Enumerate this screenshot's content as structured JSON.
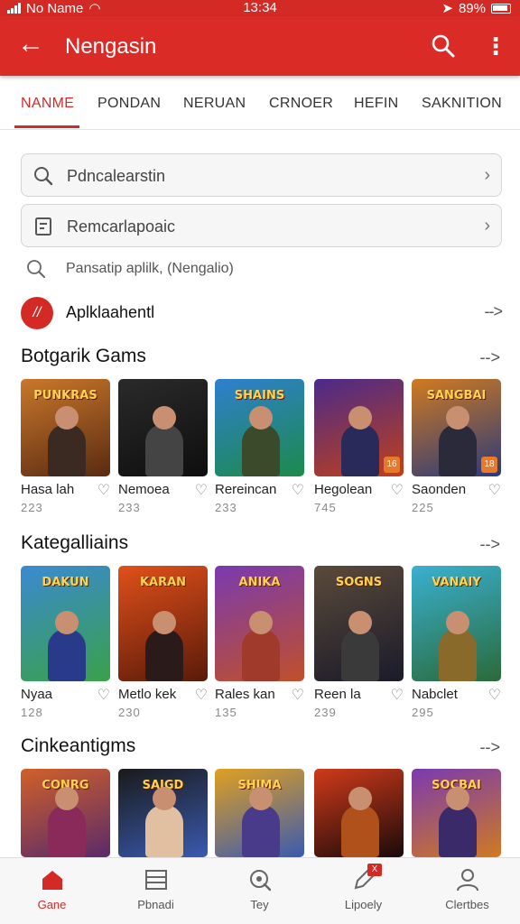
{
  "status_bar": {
    "carrier": "No Name",
    "time": "13:34",
    "battery": "89%"
  },
  "app_bar": {
    "title": "Nengasin"
  },
  "tabs": [
    {
      "label": "NANME",
      "active": true
    },
    {
      "label": "PONDAN",
      "active": false
    },
    {
      "label": "NERUAN",
      "active": false
    },
    {
      "label": "CRNOER",
      "active": false
    },
    {
      "label": "HEFIN",
      "active": false
    },
    {
      "label": "SAKNITION",
      "active": false
    }
  ],
  "fields": [
    {
      "text": "Pdncalearstin",
      "icon": "search-icon"
    },
    {
      "text": "Remcarlapoaic",
      "icon": "document-icon"
    }
  ],
  "plain_search": {
    "text": "Pansatip aplilk, (Nengalio)",
    "icon": "search-icon"
  },
  "featured": {
    "label": "Aplklaahentl",
    "badge": "//",
    "arrow": "-->"
  },
  "sections": [
    {
      "title": "Botgarik Gams",
      "arrow": "-->",
      "items": [
        {
          "name": "Hasa lah",
          "count": "223",
          "banner": "PUNKRAS",
          "colors": [
            "#c9782a",
            "#5a2a12"
          ],
          "hero": "#3a2a22",
          "tag": ""
        },
        {
          "name": "Nemoea",
          "count": "233",
          "banner": "",
          "colors": [
            "#2a2a2a",
            "#0e0e0e"
          ],
          "hero": "#444444",
          "tag": ""
        },
        {
          "name": "Rereincan",
          "count": "233",
          "banner": "SHAINS",
          "colors": [
            "#2f7fd0",
            "#1c8a4a"
          ],
          "hero": "#3a4a2a",
          "tag": ""
        },
        {
          "name": "Hegolean",
          "count": "745",
          "banner": "",
          "colors": [
            "#4a2a8a",
            "#c0401a"
          ],
          "hero": "#2a2a5a",
          "tag": "16"
        },
        {
          "name": "Saonden",
          "count": "225",
          "banner": "SANGBAI",
          "colors": [
            "#d07a20",
            "#2a3a7a"
          ],
          "hero": "#2a2a3a",
          "tag": "18"
        }
      ]
    },
    {
      "title": "Kategalliains",
      "arrow": "-->",
      "items": [
        {
          "name": "Nyaa",
          "count": "128",
          "banner": "DAKUN",
          "colors": [
            "#3a8ad0",
            "#3aa04a"
          ],
          "hero": "#2a3a8a",
          "tag": ""
        },
        {
          "name": "Metlo kek",
          "count": "230",
          "banner": "KARAN",
          "colors": [
            "#e0501a",
            "#5a1a0a"
          ],
          "hero": "#2a1a1a",
          "tag": ""
        },
        {
          "name": "Rales kan",
          "count": "135",
          "banner": "ANIKA",
          "colors": [
            "#7a3ab0",
            "#c0502a"
          ],
          "hero": "#a03a2a",
          "tag": ""
        },
        {
          "name": "Reen la",
          "count": "239",
          "banner": "SOGNS",
          "colors": [
            "#5a4a3a",
            "#1a1a2a"
          ],
          "hero": "#3a3a3a",
          "tag": ""
        },
        {
          "name": "Nabclet",
          "count": "295",
          "banner": "VANAIY",
          "colors": [
            "#3ab0d0",
            "#2a6a3a"
          ],
          "hero": "#8a6a2a",
          "tag": ""
        }
      ]
    },
    {
      "title": "Cinkeantigms",
      "arrow": "-->",
      "items": [
        {
          "name": "",
          "count": "",
          "banner": "CONRG",
          "colors": [
            "#d0602a",
            "#5a2a6a"
          ],
          "hero": "#8a2a5a",
          "tag": ""
        },
        {
          "name": "",
          "count": "",
          "banner": "SAIGD",
          "colors": [
            "#1a1a1a",
            "#3a5ab0"
          ],
          "hero": "#e0c0a0",
          "tag": ""
        },
        {
          "name": "",
          "count": "",
          "banner": "SHIMA",
          "colors": [
            "#e0a020",
            "#3a5ab0"
          ],
          "hero": "#4a3a8a",
          "tag": ""
        },
        {
          "name": "",
          "count": "",
          "banner": "",
          "colors": [
            "#d03a1a",
            "#1a0a0a"
          ],
          "hero": "#b0501a",
          "tag": ""
        },
        {
          "name": "",
          "count": "",
          "banner": "SOCBAI",
          "colors": [
            "#7a3ab0",
            "#d07a20"
          ],
          "hero": "#3a2a6a",
          "tag": ""
        }
      ]
    }
  ],
  "bottom_nav": [
    {
      "label": "Gane",
      "icon": "home-icon",
      "active": true
    },
    {
      "label": "Pbnadi",
      "icon": "grid-icon",
      "active": false
    },
    {
      "label": "Tey",
      "icon": "search-icon",
      "active": false
    },
    {
      "label": "Lipoely",
      "icon": "edit-icon",
      "active": false,
      "badge": "X"
    },
    {
      "label": "Clertbes",
      "icon": "profile-icon",
      "active": false
    }
  ],
  "colors": {
    "accent": "#d42a26"
  }
}
